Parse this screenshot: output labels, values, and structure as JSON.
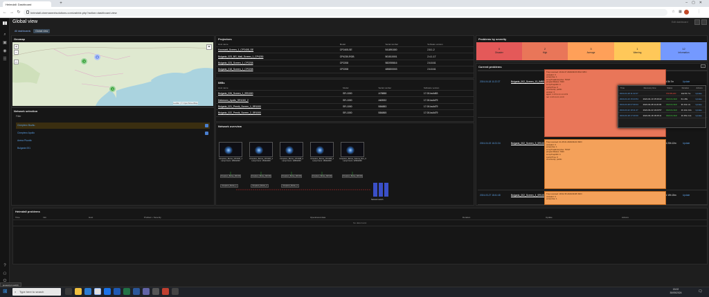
{
  "browser": {
    "tab_title": "Heimdall: Dashboard",
    "url": "heimdall.cinemanextsolutions.com/zabbix.php?action=dashboard.view",
    "new_tab": "+"
  },
  "page": {
    "title": "Global view",
    "breadcrumbs": [
      "All dashboards",
      "Global view"
    ],
    "top_right_label": "Edit dashboard"
  },
  "geomap": {
    "title": "Geomap",
    "zoom_in": "+",
    "zoom_out": "−",
    "clusters": [
      "3",
      "1",
      "3"
    ],
    "credit": "Leaflet | © OpenStreetMap"
  },
  "network_selection": {
    "title": "Network selection",
    "filter_label": "Filter",
    "items": [
      {
        "label": "Cineplexx Buzău",
        "checked": true
      },
      {
        "label": "Cineplexx Apollo",
        "checked": true
      },
      {
        "label": "Arena Plovdiv",
        "checked": false
      },
      {
        "label": "Bulgaria 001",
        "checked": false
      }
    ]
  },
  "projectors": {
    "title": "Projectors",
    "columns": [
      "Host name",
      "Model",
      "Serial number",
      "Software version"
    ],
    "rows": [
      [
        "Kosmonit_Screen_1_CP2405_SE",
        "CP2405-SE",
        "541891800",
        "2.8.1.2"
      ],
      [
        "Bulgaria_023_BG_Mall_Screen_1_CP4230",
        "CP4230-RGB",
        "501510001",
        "2.4.1.17"
      ],
      [
        "Bulgaria_023_Screen_1_CP2208",
        "CP2208",
        "582055816",
        "2.6.8.61"
      ],
      [
        "Bulgaria_018_Screen_1_CP2208",
        "CP2208",
        "485800003",
        "2.6.8.61"
      ]
    ]
  },
  "imbs": {
    "title": "IMBs",
    "columns": [
      "Host name",
      "Model",
      "Serial number",
      "Software version"
    ],
    "rows": [
      [
        "Bulgaria_026_Screen_1_SR1000",
        "SR-1000",
        "A78888",
        "17.00-build83"
      ],
      [
        "Debrecen_Apollo_SR1000_2",
        "SR-1000",
        "A60532",
        "17.00-build79"
      ],
      [
        "Bulgaria_021_Pernik_Screen_1_SR1000",
        "SR-1000",
        "B84883",
        "17.00-build79"
      ],
      [
        "Bulgaria_022_Pernik_Screen_2_SR1000",
        "SR-1000",
        "B84865",
        "17.00-build79"
      ]
    ]
  },
  "network_overview": {
    "title": "Network overview",
    "projectors": [
      "Cineplexx_Buzau_CP2230_1\nLamp hours: 1954/2000",
      "Cineplexx_Buzau_CP2230_2\nLamp hours: 1532/2000",
      "Cineplexx_Buzau_CP2208_3\nLamp hours: 1286/2000",
      "Cineplexx_Buzau_CP2208_4\nLamp hours: 1832/2000",
      "Cineplexx_Buzau_Satuna_Dex_5\nLamp hours: 1256/2000"
    ],
    "imbs": [
      "Cineplexx_Buzau_SR1000_1",
      "Cineplexx_Buzau_SR1000_2",
      "Cineplexx_Buzau_SR1000_3",
      "Cineplexx_Buzau_SR1000_4",
      "Cineplexx_Buzau_SR1000_5"
    ],
    "servers": [
      "Cineplexx_Buzau_1",
      "Cineplexx_Buzau_2",
      "Cineplexx_Buzau_3"
    ],
    "switch_label": "Network switch"
  },
  "problems_by_severity": {
    "title": "Problems by severity",
    "levels": [
      {
        "count": "0",
        "label": "Disaster",
        "color": "#e45959"
      },
      {
        "count": "2",
        "label": "High",
        "color": "#e97659"
      },
      {
        "count": "3",
        "label": "Average",
        "color": "#ffa059"
      },
      {
        "count": "1",
        "label": "Warning",
        "color": "#ffc859"
      },
      {
        "count": "12",
        "label": "Information",
        "color": "#7499ff"
      }
    ]
  },
  "current_problems": {
    "title": "Current problems",
    "rows": [
      {
        "time": "2024-04-18 11:22:27",
        "host": "Bulgaria_002_Screen_13_IMB3000",
        "detail": "Trap received: 16.02.27 2024/04/15 RSU NPCI\nvarsalert: 3\nenterprise: 1\nsnmpTrapEnterprise: TRUP\nprogramStatus: SSN\nsnmpTrapOID: 0\nsysUpTime: 0\ncommunity: public\nversion: 0\nagent: 1.3.6.1.4.1.1.4.0.9\nnet: 1.3.6.1.2.1.1.3.0",
        "duration": "13d 5h 7m",
        "action": "Update"
      },
      {
        "time": "2024-04-02 16:21:34",
        "host": "Bulgaria_002_Screen_3_SR1000",
        "detail": "Trap received: 21.25.01 2024/04/22 INFO\nvarsalert: 3\nenterprise: 1\nsnmpTrapEnterprise: TRUP\nprogramStatus: SSN\nsnmpTrapOID: 0\nsysUpTime: 0\ncommunity: public",
        "duration": "19d 23h 12m",
        "action": "Update"
      },
      {
        "time": "2024-03-27 18:41:48",
        "host": "Bulgaria_002_Screen_4_SR1000",
        "detail": "Trap received: 18:02.35 2024/04/08 INFO\nvarsalert: 3\nenterprise: 1",
        "duration": "20d 19h 15m",
        "action": "Update"
      }
    ],
    "popup": {
      "columns": [
        "Time",
        "Recovery time",
        "Status",
        "Duration",
        "Actions"
      ],
      "rows": [
        [
          "2024-04-18 11:22:27",
          "",
          "PROBLEM",
          "13d 5h 7m",
          "Update"
        ],
        [
          "2024-04-10 15:23:54",
          "2024-04-10 15:30:22",
          "RESOLVED",
          "6m 28s",
          "Update"
        ],
        [
          "2024-03-28 07:36:04",
          "2024-03-28 11:20:06",
          "RESOLVED",
          "3h 44m 2s",
          "Update"
        ],
        [
          "2024-03-22 18:11:47",
          "2024-03-22 19:23:57",
          "RESOLVED",
          "1h 12m 10s",
          "Update"
        ],
        [
          "2024-03-18 17:20:00",
          "2024-03-18 18:45:11",
          "RESOLVED",
          "1h 25m 11s",
          "Update"
        ]
      ]
    }
  },
  "heimdall_problems": {
    "title": "Heimdall problems",
    "columns": [
      "Time",
      "Info",
      "Host",
      "Problem • Severity",
      "Operational data",
      "Duration",
      "Update",
      "Actions"
    ],
    "empty": "No data found."
  },
  "taskbar": {
    "search_placeholder": "Type here to search",
    "time": "15:02",
    "date": "30/05/2024",
    "status_url": "javascript:void(0)"
  }
}
